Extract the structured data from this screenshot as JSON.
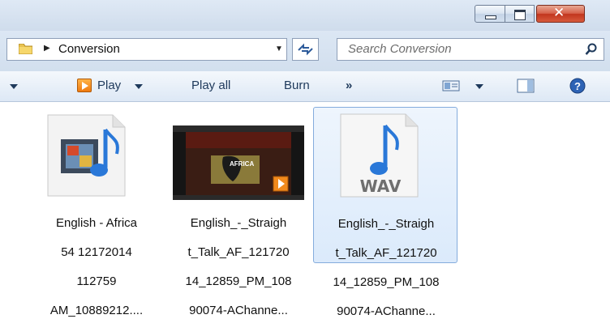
{
  "window": {
    "buttons": {
      "minimize": "minimize",
      "maximize": "maximize",
      "close": "close"
    }
  },
  "address": {
    "breadcrumb": "Conversion",
    "search_placeholder": "Search Conversion"
  },
  "toolbar": {
    "play_label": "Play",
    "play_all_label": "Play all",
    "burn_label": "Burn",
    "more_label": "»"
  },
  "files": [
    {
      "label_lines": [
        "English - Africa",
        "54 12172014",
        "112759",
        "AM_10889212...."
      ],
      "icon": "audio-file-icon"
    },
    {
      "label_lines": [
        "English_-_Straigh",
        "t_Talk_AF_121720",
        "14_12859_PM_108",
        "90074-AChanne..."
      ],
      "icon": "video-thumbnail",
      "thumb_caption": "AFRICA"
    },
    {
      "label_lines": [
        "English_-_Straigh",
        "t_Talk_AF_121720",
        "14_12859_PM_108",
        "90074-AChanne..."
      ],
      "icon": "wav-file-icon",
      "badge": "WAV",
      "selected": true
    }
  ],
  "colors": {
    "accent": "#1e395b",
    "selection": "#dbeafb",
    "close": "#c2361e"
  }
}
